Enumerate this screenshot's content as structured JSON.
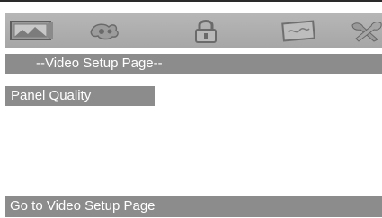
{
  "icon_bar": {
    "tabs": [
      {
        "icon": "landscape-picture-icon"
      },
      {
        "icon": "speaker-audio-icon"
      },
      {
        "icon": "padlock-icon"
      },
      {
        "icon": "preference-card-icon"
      },
      {
        "icon": "crossed-tools-icon"
      }
    ]
  },
  "header": {
    "title": "--Video Setup Page--"
  },
  "menu": {
    "items": [
      {
        "label": "Panel Quality"
      }
    ]
  },
  "status": {
    "text": "Go to Video Setup Page"
  },
  "colors": {
    "bar_gray": "#8c8c8c",
    "icon_bar_gray": "#adadad",
    "text_white": "#ffffff"
  }
}
